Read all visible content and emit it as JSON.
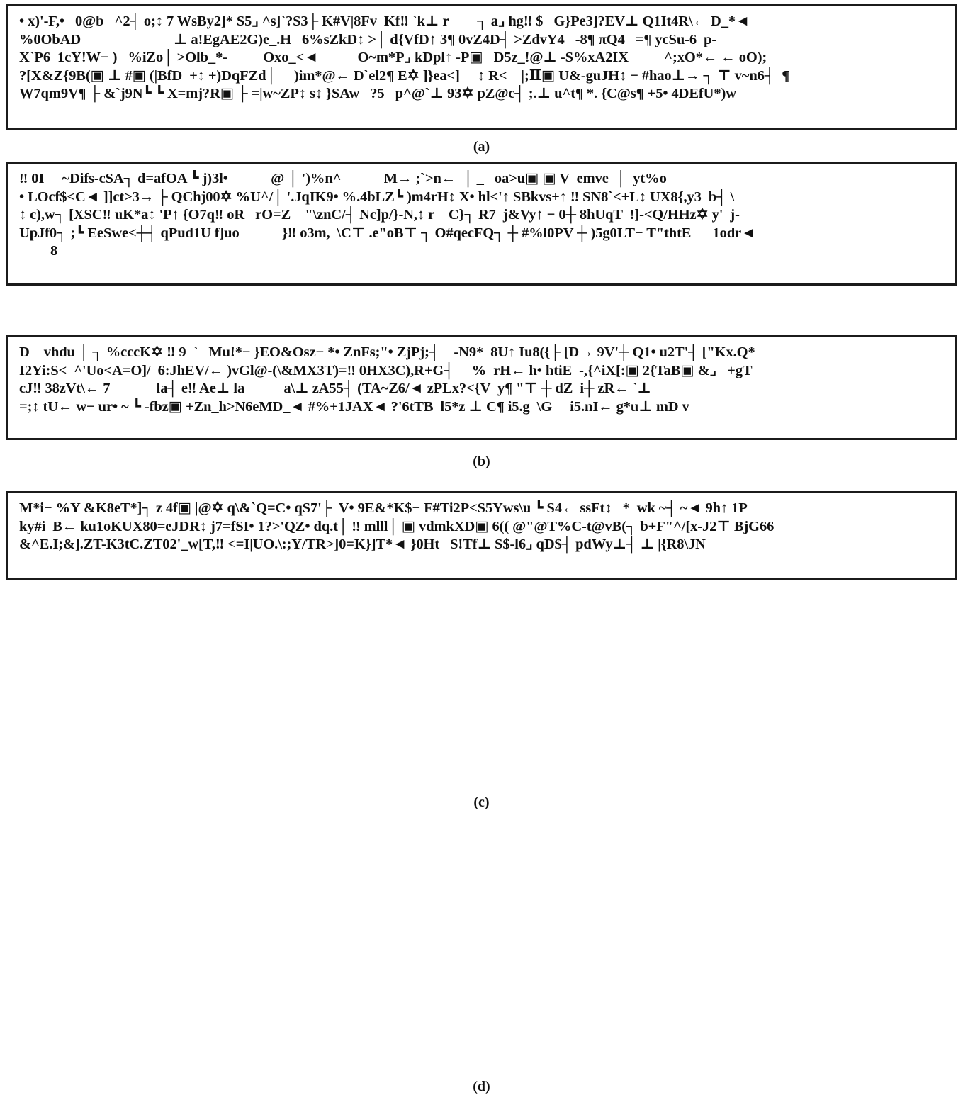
{
  "document": {
    "kind": "scanned-figure",
    "background_color": "#ffffff",
    "text_color": "#111111",
    "border_color": "#1b1b1b",
    "panel_count": 4
  },
  "panels": [
    {
      "id": "a",
      "caption": "(a)",
      "lines": [
        "• x)'-F,•   0@b   ^2┤ o;↕ 7 WsBy2]* S5⌟ ^s]`?S3├ K#V|8Fv  Kf‼ `k⊥ r        ┐ a⌟ hg‼ $   G}Pe3]?EV⊥ Q1It4R\\← D_*◄",
        "%0ObAD                          ⊥ a!EgAE2G)e_.H   6%sZkD↕ >│ d{VfD↑ 3¶ 0vZ4D┤ >ZdvY4   -8¶ πQ4   =¶ ycSu-6  p-",
        "X`P6  1cY!W− )   %iZo│ >Olb_*-          Oxo_<◄           O~m*P⌟ kDpl↑ -P▣   D5z_!@⊥ -S%xA2IX          ^;xO*← ← oO);",
        "?[X&Z{9B(▣ ⊥ #▣ (|BfD  +↕ +)DqFZd│     )im*@← D`el2¶ E✡ ]}ea<]     ↕ R<    |;Ⅱ▣ U&-guJH↕ − #hao⊥→ ┐ ⊤ v~n6┤  ¶",
        "W7qm9V¶ ├ &`j9N┗ ┗ X=mj?R▣ ├ =|w~ZP↕ s↕ }SAw   ?5   p^@`⊥ 93✡ pZ@c┤ ;.⊥ u^t¶ *. {C@s¶ +5• 4DEfU*)w"
      ]
    },
    {
      "id": "b",
      "caption": "(b)",
      "lines": [
        "‼ 0I     ~Difs-cSA┐ d=afOA ┗ j)3l•            @ │ ')%n^            M→ ;`>n←  │ _   oa>u▣ ▣ V  emve  │  yt%o",
        "• LOcf$<C◄ ]]ct>3→ ├ QChj00✡ %U^/│ '.JqIK9• %.4bLZ┗ )m4rH↕ X• hl<'↑ SBkvs+↑ ‼ SN8`<+L↕ UX8{,y3  b┤ \\",
        "↕ c),w┐ [XSC‼ uK*a↕ 'P↑ {O7q‼ oR   rO=Z    \"\\znC/┤ Nc]p/}-N,↕ r    C}┐ R7  j&Vy↑ − 0┼ 8hUqT  !]-<Q/HHz✡ y'  j-",
        "UpJf0┐ ;┗ EeSwe<┼┤ qPud1U f]uo            }‼ o3m,  \\C⊤ .e\"oB⊤ ┐ O#qecFQ┐ ┼ #%l0PV ┼ )5g0LT− T\"thtE      1odr◄",
        "8"
      ]
    },
    {
      "id": "c",
      "caption": "(c)",
      "lines": [
        "D    vhdu │ ┐ %cccK✡ ‼ 9  `   Mu!*− }EO&Osz− *• ZnFs;\"• ZjPj;┤    -N9*  8U↑ Iu8({├ [D→ 9V'┼ Q1• u2T'┤ [\"Kx.Q*",
        "I2Yi:S<  ^'Uo<A=O]/  6:JhEV/← )vGl@-(\\&MX3T)=‼ 0HX3C),R+G┤     %  rH← h• htiE  -,{^iX[:▣ 2{TaB▣ &⌟   +gT",
        "cJ‼ 38zVt\\← 7             la┤ e‼ Ae⊥ la           a\\⊥ zA55┤ (TA~Z6/◄ zPLx?<{V  y¶ \"⊤ ┼ dZ  i┼ zR← `⊥",
        "=;↕ tU← w− ur• ~ ┗ -fbz▣ +Zn_h>N6eMD_◄ #%+1JAX◄ ?'6tTB  l5*z ⊥ C¶ i5.g  \\G     i5.nI← g*u⊥ mD v"
      ]
    },
    {
      "id": "d",
      "caption": "(d)",
      "lines": [
        "M*i− %Y &K8eT*]┐ z 4f▣ |@✡ q\\&`Q=C• qS7'├  V• 9E&*K$− F#Ti2P<S5Yws\\u ┗ S4← ssFt↕   *  wk ~┤ ~◄ 9h↑ 1P",
        "ky#i  B← ku1oKUX80=eJDR↕ j7=fSI• 1?>'QZ• dq.t│ ‼ mlll│ ▣ vdmkXD▣ 6(( @\"@T%C-t@vB(┐ b+F\"^/[x-J2⊤ BjG66",
        "&^E.I;&].ZT-K3tC.ZT02'_w[T,‼ <=I|UO.\\:;Y/TR>]0=K}]T*◄ }0Ht   S!Tf⊥ S$-l6⌟ qD$┤ pdWy⊥┤ ⊥ |{R8\\JN"
      ]
    }
  ]
}
